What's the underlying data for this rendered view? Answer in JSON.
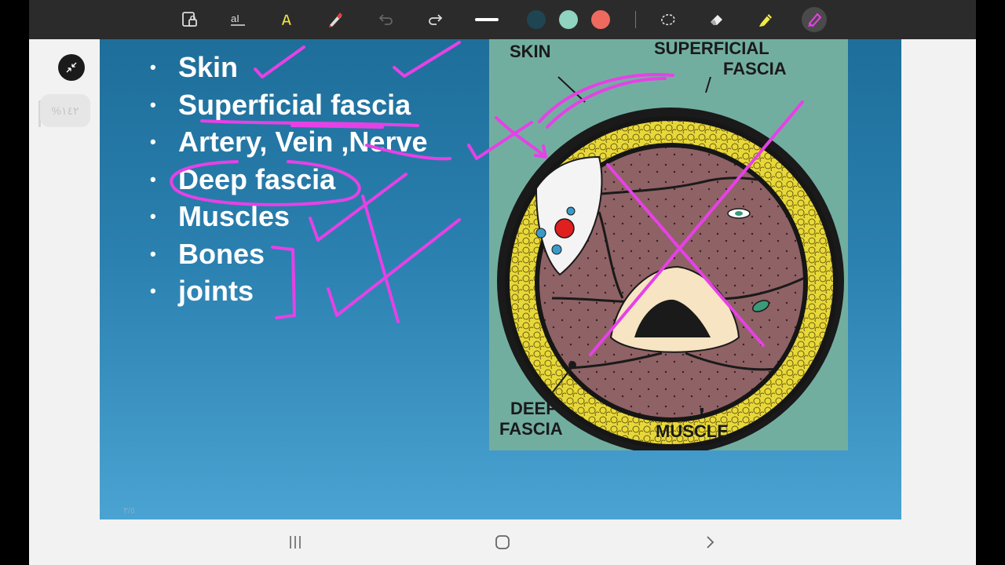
{
  "toolbar": {
    "tools": [
      "read-mode-icon",
      "text-tool-icon",
      "text-style-icon",
      "pen-icon",
      "undo-icon",
      "redo-icon",
      "stroke-width-icon",
      "lasso-icon",
      "eraser-icon",
      "highlighter-icon",
      "active-pen-icon"
    ],
    "colors": [
      "#1f4552",
      "#8fd3c0",
      "#ef6a5e"
    ]
  },
  "sidebar": {
    "zoom_label": "%١٤٢"
  },
  "slide": {
    "bullets": [
      "Skin",
      "Superficial fascia",
      "Artery, Vein ,Nerve",
      "Deep fascia",
      "Muscles",
      "Bones",
      "joints"
    ],
    "page_number": "٣/٥"
  },
  "diagram": {
    "labels": {
      "skin": "SKIN",
      "superficial_1": "SUPERFICIAL",
      "superficial_2": "FASCIA",
      "deep_1": "DEEP",
      "deep_2": "FASCIA",
      "muscle": "MUSCLE"
    }
  },
  "annotation_color": "#e641e6",
  "nav": {
    "buttons": [
      "recent-apps-icon",
      "home-icon",
      "back-icon"
    ]
  }
}
